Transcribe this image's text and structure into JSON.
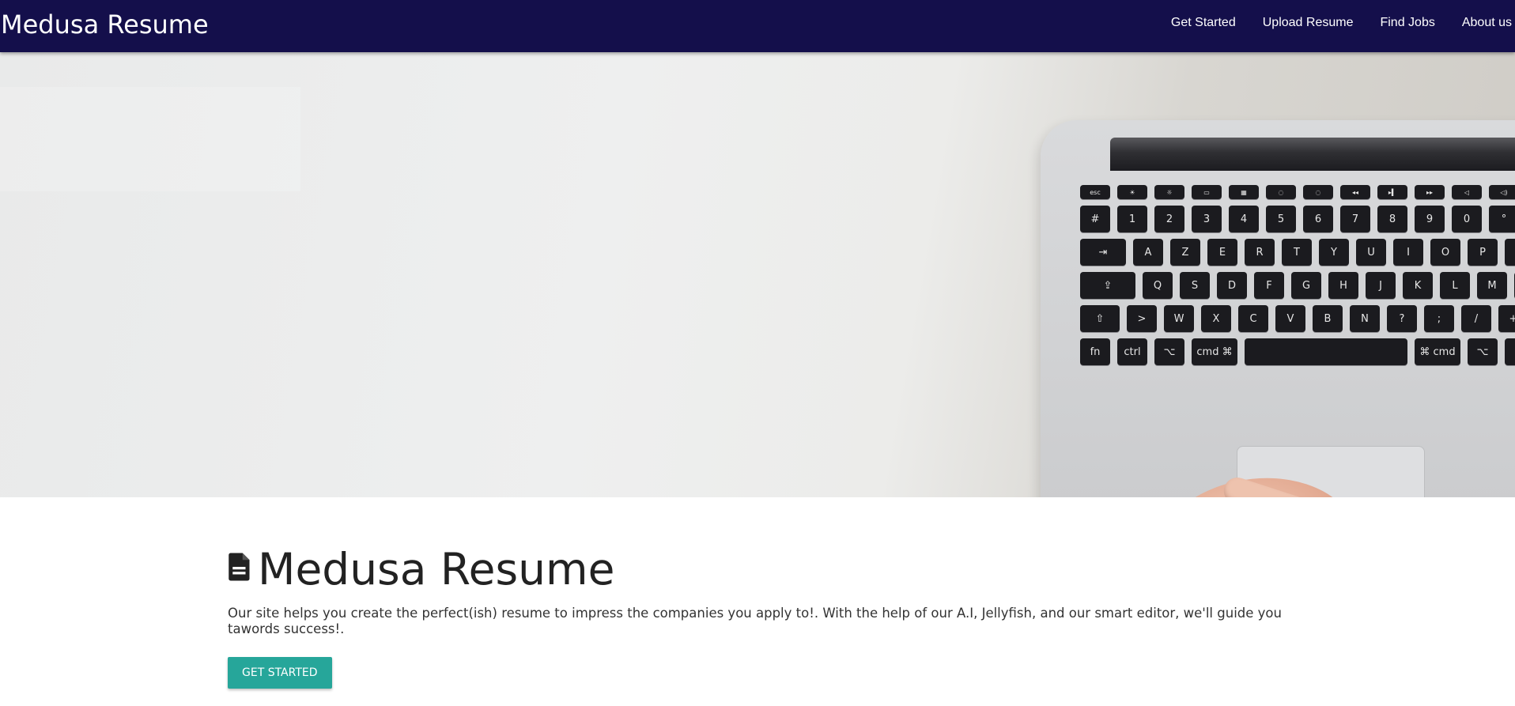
{
  "navbar": {
    "brand": "Medusa Resume",
    "links": [
      {
        "label": "Get Started"
      },
      {
        "label": "Upload Resume"
      },
      {
        "label": "Find Jobs"
      },
      {
        "label": "About us"
      }
    ],
    "background_color": "#140f4b"
  },
  "hero": {
    "image": "laptop-keyboard-photo",
    "keyboard_rows": [
      [
        "esc",
        "☀",
        "☼",
        "▭",
        "▦",
        "◌",
        "◌",
        "◂◂",
        "▸▍",
        "▸▸",
        "◁",
        "◁)"
      ],
      [
        "#",
        "1",
        "2",
        "3",
        "4",
        "5",
        "6",
        "7",
        "8",
        "9",
        "0",
        "°",
        "-"
      ],
      [
        "⇥",
        "A",
        "Z",
        "E",
        "R",
        "T",
        "Y",
        "U",
        "I",
        "O",
        "P",
        "¨"
      ],
      [
        "⇪",
        "Q",
        "S",
        "D",
        "F",
        "G",
        "H",
        "J",
        "K",
        "L",
        "M",
        "%"
      ],
      [
        "⇧",
        ">",
        "W",
        "X",
        "C",
        "V",
        "B",
        "N",
        "?",
        ";",
        "/",
        "+"
      ],
      [
        "fn",
        "ctrl",
        "⌥",
        "cmd ⌘",
        "",
        "⌘ cmd",
        "⌥",
        "◂"
      ]
    ]
  },
  "main": {
    "title": "Medusa Resume",
    "title_icon": "document-icon",
    "intro": "Our site helps you create the perfect(ish) resume to impress the companies you apply to!. With the help of our A.I, Jellyfish, and our smart editor, we'll guide you tawords success!.",
    "cta_label": "GET STARTED",
    "cta_color": "#26a69a"
  }
}
